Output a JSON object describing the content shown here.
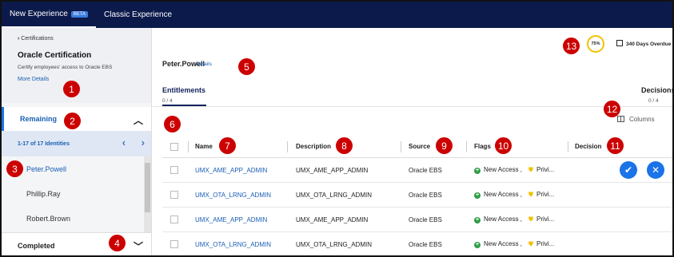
{
  "topbar": {
    "tab_new": "New Experience",
    "beta": "BETA",
    "tab_classic": "Classic Experience"
  },
  "sidebar": {
    "back_label": "Certifications",
    "title": "Oracle Certification",
    "description": "Certify employees' access to Oracle EBS",
    "more_details": "More Details",
    "remaining_label": "Remaining",
    "identities_count": "1-17 of 17 Identities",
    "people": [
      "Peter.Powell",
      "Phillip.Ray",
      "Robert.Brown"
    ],
    "completed_label": "Completed"
  },
  "header": {
    "progress": "75%",
    "overdue": "340 Days Overdue",
    "person_name": "Peter.Powell",
    "details_link": "Details"
  },
  "tabs": {
    "entitlements": "Entitlements",
    "entitlements_count": "0 / 4",
    "decisions": "Decisions",
    "decisions_count": "0 / 4"
  },
  "table": {
    "columns_button": "Columns",
    "headers": {
      "name": "Name",
      "description": "Description",
      "source": "Source",
      "flags": "Flags",
      "decision": "Decision"
    },
    "rows": [
      {
        "name": "UMX_AME_APP_ADMIN",
        "description": "UMX_AME_APP_ADMIN",
        "source": "Oracle EBS",
        "flag1": "New Access ,",
        "flag2": "Privi..."
      },
      {
        "name": "UMX_OTA_LRNG_ADMIN",
        "description": "UMX_OTA_LRNG_ADMIN",
        "source": "Oracle EBS",
        "flag1": "New Access ,",
        "flag2": "Privi..."
      },
      {
        "name": "UMX_AME_APP_ADMIN",
        "description": "UMX_AME_APP_ADMIN",
        "source": "Oracle EBS",
        "flag1": "New Access ,",
        "flag2": "Privi..."
      },
      {
        "name": "UMX_OTA_LRNG_ADMIN",
        "description": "UMX_OTA_LRNG_ADMIN",
        "source": "Oracle EBS",
        "flag1": "New Access ,",
        "flag2": "Privi..."
      }
    ]
  },
  "markers": [
    "1",
    "2",
    "3",
    "4",
    "5",
    "6",
    "7",
    "8",
    "9",
    "10",
    "11",
    "12",
    "13"
  ],
  "colors": {
    "topbar": "#0c1a4b",
    "accent": "#1a73e8",
    "marker": "#cc0000"
  }
}
